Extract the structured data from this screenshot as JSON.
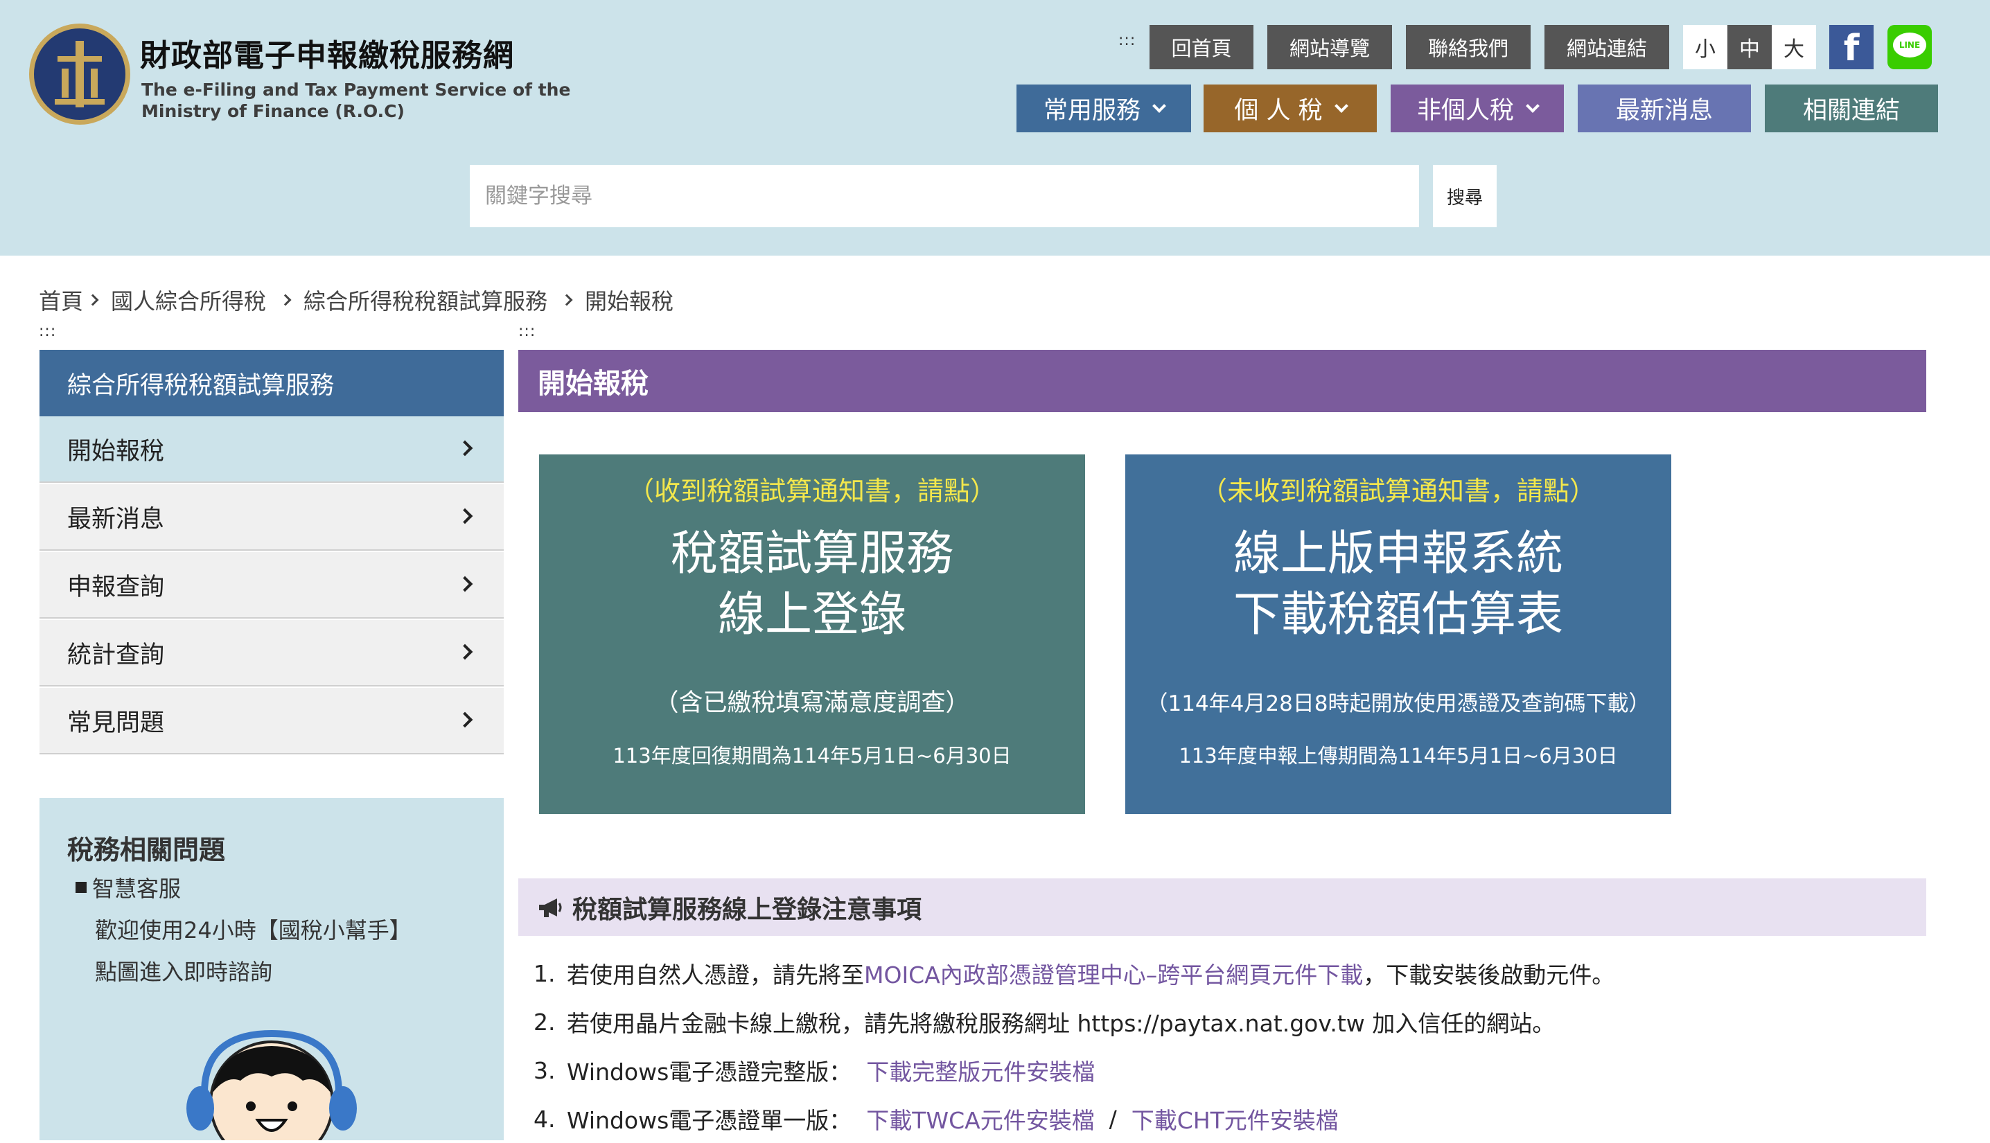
{
  "header": {
    "site_title": "財政部電子申報繳稅服務網",
    "site_subtitle_1": "The e-Filing and Tax Payment Service of the",
    "site_subtitle_2": "Ministry of Finance (R.O.C)",
    "accesskey_symbol": ":::",
    "top_links": [
      "回首頁",
      "網站導覽",
      "聯絡我們",
      "網站連結"
    ],
    "font_sizes": [
      "小",
      "中",
      "大"
    ],
    "facebook_label": "f",
    "line_label": "LINE",
    "main_nav": [
      {
        "label": "常用服務",
        "color": "#3f6b99"
      },
      {
        "label": "個 人 稅",
        "color": "#97662a"
      },
      {
        "label": "非個人稅",
        "color": "#7b5b9c"
      },
      {
        "label": "最新消息",
        "color": "#6874b2"
      },
      {
        "label": "相關連結",
        "color": "#4e7b7a"
      }
    ],
    "search_placeholder": "關鍵字搜尋",
    "search_button": "搜尋"
  },
  "breadcrumb": [
    "首頁",
    "國人綜合所得稅",
    "綜合所得稅稅額試算服務",
    "開始報稅"
  ],
  "sidebar": {
    "title": "綜合所得稅稅額試算服務",
    "items": [
      "開始報稅",
      "最新消息",
      "申報查詢",
      "統計查詢",
      "常見問題"
    ],
    "faq_title": "稅務相關問題",
    "faq_sub": "智慧客服",
    "faq_line_1": "歡迎使用24小時【國稅小幫手】",
    "faq_line_2": "點圖進入即時諮詢"
  },
  "main": {
    "page_title": "開始報稅",
    "card_left": {
      "top": "（收到稅額試算通知書，請點）",
      "line1": "稅額試算服務",
      "line2": "線上登錄",
      "note": "（含已繳稅填寫滿意度調查）",
      "period": "113年度回復期間為114年5月1日~6月30日",
      "color": "#4e7b7a"
    },
    "card_right": {
      "top": "（未收到稅額試算通知書，請點）",
      "line1": "線上版申報系統",
      "line2": "下載稅額估算表",
      "note": "（114年4月28日8時起開放使用憑證及查詢碼下載）",
      "period": "113年度申報上傳期間為114年5月1日~6月30日",
      "color": "#41709a"
    },
    "notice_title": "稅額試算服務線上登錄注意事項",
    "notices": [
      {
        "num": "1.",
        "pre": "若使用自然人憑證，請先將至 ",
        "link": "MOICA內政部憑證管理中心–跨平台網頁元件下載",
        "post": " ，下載安裝後啟動元件。"
      },
      {
        "num": "2.",
        "pre": "若使用晶片金融卡線上繳稅，請先將繳稅服務網址 https://paytax.nat.gov.tw 加入信任的網站。"
      },
      {
        "num": "3.",
        "pre": "Windows電子憑證完整版：  ",
        "link": "下載完整版元件安裝檔"
      },
      {
        "num": "4.",
        "pre": "Windows電子憑證單一版：  ",
        "link": "下載TWCA元件安裝檔",
        "sep": "  /  ",
        "link2": "下載CHT元件安裝檔"
      }
    ]
  }
}
